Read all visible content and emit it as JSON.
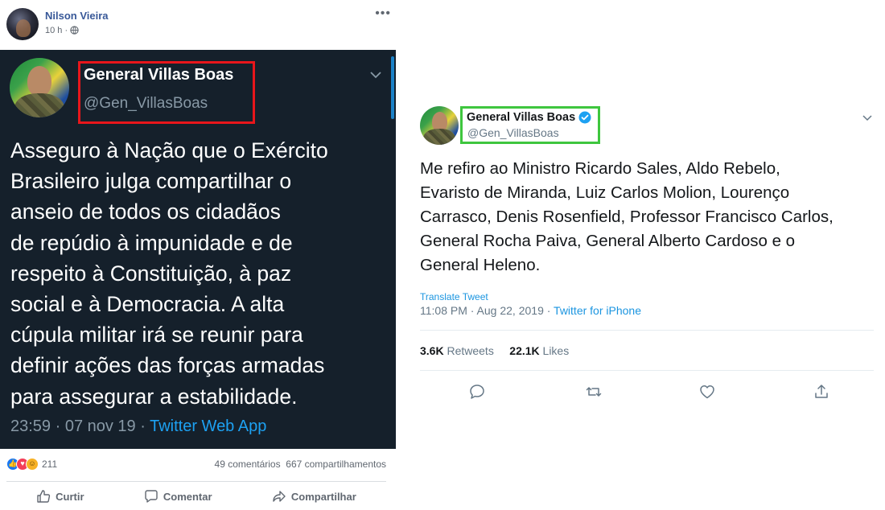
{
  "facebook": {
    "author": "Nilson Vieira",
    "time": "10 h ·",
    "more_icon": "more-icon",
    "reactions": {
      "count": "211",
      "types": [
        "like",
        "love",
        "haha"
      ]
    },
    "comments": "49 comentários",
    "shares": "667 compartilhamentos",
    "actions": {
      "like": "Curtir",
      "comment": "Comentar",
      "share": "Compartilhar"
    }
  },
  "screenshot_tweet": {
    "name": "General Villas Boas",
    "handle": "@Gen_VillasBoas",
    "text_lines": [
      "Asseguro à Nação que o Exército",
      "Brasileiro julga compartilhar o",
      "anseio de todos os cidadãos",
      "de repúdio à impunidade e de",
      "respeito à Constituição, à paz",
      "social e à Democracia. A alta",
      "cúpula militar irá se reunir para",
      "definir ações das forças armadas",
      "para assegurar a estabilidade."
    ],
    "timestamp": "23:59 · 07 nov 19 · ",
    "source": "Twitter Web App",
    "highlight_color": "#e8161b"
  },
  "tweet": {
    "name": "General Villas Boas",
    "handle": "@Gen_VillasBoas",
    "verified": true,
    "text_lines": [
      "Me refiro ao Ministro Ricardo Sales, Aldo Rebelo,",
      "Evaristo de Miranda, Luiz Carlos Molion, Lourenço",
      "Carrasco, Denis Rosenfield, Professor Francisco Carlos,",
      "General Rocha Paiva, General Alberto Cardoso e o",
      "General Heleno."
    ],
    "translate": "Translate Tweet",
    "timestamp": "11:08 PM · Aug 22, 2019 · ",
    "source": "Twitter for iPhone",
    "retweets_count": "3.6K",
    "retweets_label": " Retweets",
    "likes_count": "22.1K",
    "likes_label": " Likes",
    "highlight_color": "#3ec63e"
  }
}
